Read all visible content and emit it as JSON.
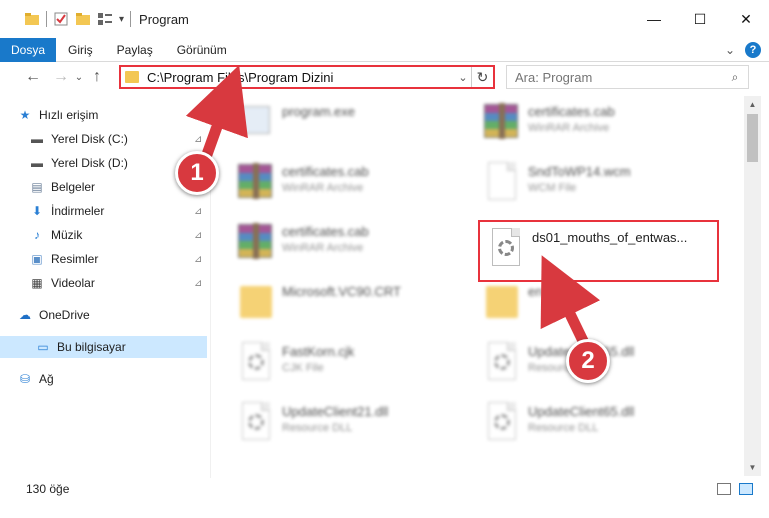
{
  "window": {
    "title": "Program",
    "controls": {
      "minimize": "—",
      "maximize": "☐",
      "close": "✕"
    }
  },
  "ribbon": {
    "tabs": [
      "Dosya",
      "Giriş",
      "Paylaş",
      "Görünüm"
    ],
    "expand_icon": "⌄",
    "help_icon": "?"
  },
  "nav": {
    "back": "←",
    "forward": "→",
    "recent": "⌄",
    "up": "↑",
    "address": "C:\\Program Files\\Program Dizini",
    "dropdown": "⌄",
    "refresh": "↻",
    "search_placeholder": "Ara: Program",
    "search_icon": "⌕"
  },
  "sidebar": {
    "items": [
      {
        "label": "Hızlı erişim",
        "icon": "star-icon",
        "glyph": "★",
        "color": "#2a7fd4",
        "pinned": false
      },
      {
        "label": "Yerel Disk (C:)",
        "icon": "drive-icon",
        "glyph": "▬",
        "color": "#555555",
        "pinned": true
      },
      {
        "label": "Yerel Disk (D:)",
        "icon": "drive-icon",
        "glyph": "▬",
        "color": "#555555",
        "pinned": true
      },
      {
        "label": "Belgeler",
        "icon": "documents-icon",
        "glyph": "▤",
        "color": "#6b7f99",
        "pinned": true
      },
      {
        "label": "İndirmeler",
        "icon": "download-icon",
        "glyph": "⬇",
        "color": "#2a7fd4",
        "pinned": true
      },
      {
        "label": "Müzik",
        "icon": "music-icon",
        "glyph": "♪",
        "color": "#2a7fd4",
        "pinned": true
      },
      {
        "label": "Resimler",
        "icon": "pictures-icon",
        "glyph": "▣",
        "color": "#5a8fc9",
        "pinned": true
      },
      {
        "label": "Videolar",
        "icon": "video-icon",
        "glyph": "▦",
        "color": "#444444",
        "pinned": true
      },
      {
        "label": "OneDrive",
        "icon": "cloud-icon",
        "glyph": "☁",
        "color": "#1e6fc6",
        "pinned": false
      },
      {
        "label": "Bu bilgisayar",
        "icon": "computer-icon",
        "glyph": "▭",
        "color": "#2a7fd4",
        "pinned": false
      },
      {
        "label": "Ağ",
        "icon": "network-icon",
        "glyph": "⛁",
        "color": "#2a7fd4",
        "pinned": false
      }
    ],
    "pin_glyph": "📌"
  },
  "files": [
    {
      "name": "program.exe",
      "type": "",
      "icon": "exe"
    },
    {
      "name": "certificates.cab",
      "type": "WinRAR Archive",
      "icon": "rar"
    },
    {
      "name": "certificates.cab",
      "type": "WinRAR Archive",
      "icon": "rar"
    },
    {
      "name": "SndToWP14.wcm",
      "type": "WCM File",
      "icon": "doc"
    },
    {
      "name": "certificates.cab",
      "type": "WinRAR Archive",
      "icon": "rar"
    },
    {
      "name": "ds01_mouths_of_entwas...",
      "type": "",
      "icon": "gear"
    },
    {
      "name": "Microsoft.VC90.CRT",
      "type": "",
      "icon": "folder"
    },
    {
      "name": "en",
      "type": "",
      "icon": "folder"
    },
    {
      "name": "FastKorn.cjk",
      "type": "CJK File",
      "icon": "gear"
    },
    {
      "name": "UpdateClient65.dll",
      "type": "Resource DLL",
      "icon": "gear"
    },
    {
      "name": "UpdateClient21.dll",
      "type": "Resource DLL",
      "icon": "gear"
    },
    {
      "name": "UpdateClient65.dll",
      "type": "Resource DLL",
      "icon": "gear"
    }
  ],
  "status": {
    "count": "130 öğe"
  },
  "callouts": {
    "one": "1",
    "two": "2"
  },
  "colors": {
    "accent": "#1979ca",
    "highlight": "#e8323c",
    "callout": "#d8393f",
    "selected": "#cce8ff"
  }
}
